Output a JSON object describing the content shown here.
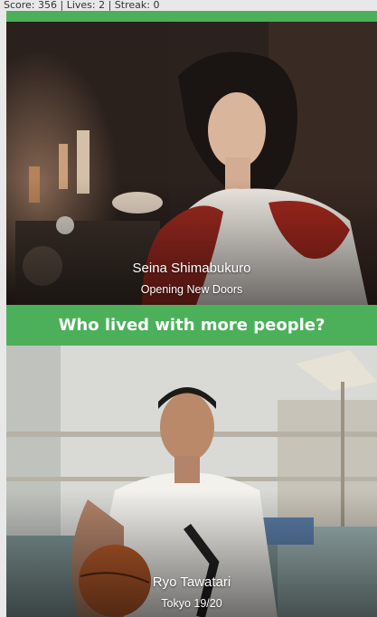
{
  "status": {
    "text": "Score: 356 | Lives: 2 | Streak: 0"
  },
  "question": {
    "text": "Who lived with more people?"
  },
  "cards": [
    {
      "name": "Seina Shimabukuro",
      "show": "Opening New Doors"
    },
    {
      "name": "Ryo Tawatari",
      "show": "Tokyo 19/20"
    }
  ],
  "colors": {
    "accent": "#4cb05a"
  }
}
